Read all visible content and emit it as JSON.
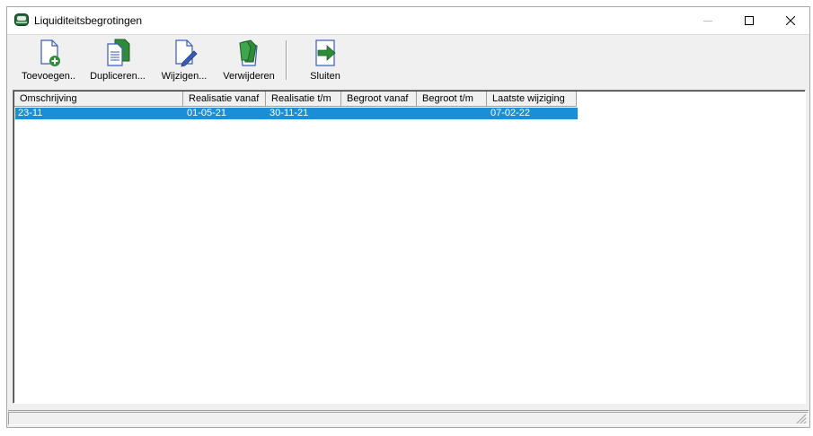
{
  "window": {
    "title": "Liquiditeitsbegrotingen",
    "icon": "bank-icon"
  },
  "titlebar_buttons": [
    "minimize-icon",
    "maximize-icon",
    "close-icon"
  ],
  "toolbar": {
    "add_label": "Toevoegen..",
    "duplicate_label": "Dupliceren...",
    "edit_label": "Wijzigen...",
    "delete_label": "Verwijderen",
    "close_label": "Sluiten"
  },
  "table": {
    "columns": [
      "Omschrijving",
      "Realisatie vanaf",
      "Realisatie t/m",
      "Begroot vanaf",
      "Begroot t/m",
      "Laatste wijziging"
    ],
    "rows": [
      [
        "23-11",
        "01-05-21",
        "30-11-21",
        "",
        "",
        "07-02-22"
      ]
    ],
    "selected_row_color": "#1a8ed6"
  },
  "colors": {
    "accent": "#1a8ed6",
    "icon_green": "#2e8b3a",
    "icon_blue": "#3a5bb8"
  }
}
